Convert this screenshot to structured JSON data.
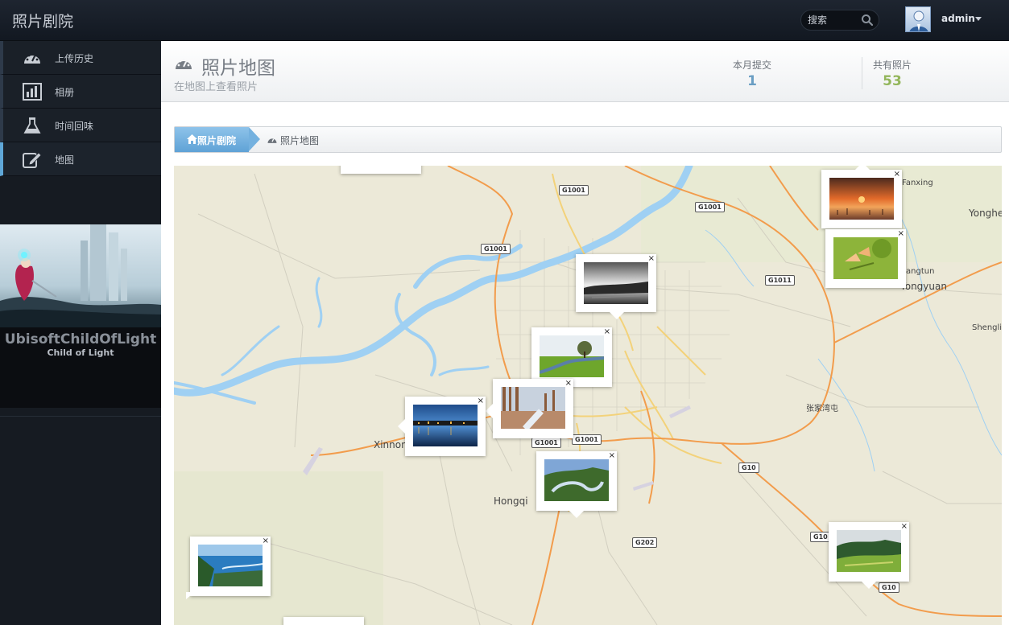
{
  "app": {
    "brand": "照片剧院"
  },
  "navbar": {
    "search_placeholder": "搜索",
    "user_name": "admin"
  },
  "sidebar": {
    "items": [
      {
        "label": "上传历史",
        "icon": "dashboard-icon"
      },
      {
        "label": "相册",
        "icon": "bar-chart-icon"
      },
      {
        "label": "时间回味",
        "icon": "flask-icon"
      },
      {
        "label": "地图",
        "icon": "edit-icon",
        "active": true
      }
    ],
    "banner": {
      "title": "UbisoftChildOfLight",
      "subtitle": "Child of Light"
    }
  },
  "header": {
    "title": "照片地图",
    "subtitle": "在地图上查看照片",
    "stats": [
      {
        "label": "本月提交",
        "value": "1",
        "color": "#6a9ec3"
      },
      {
        "label": "共有照片",
        "value": "53",
        "color": "#93b65b"
      }
    ]
  },
  "breadcrumb": {
    "home": "照片剧院",
    "current": "照片地图"
  },
  "map": {
    "place_labels": [
      "Fanxing",
      "Yonghe",
      "angtun",
      "Yongyuan",
      "Shengli",
      "张家湾屯",
      "Xinnon",
      "Hongqi"
    ],
    "road_shields": [
      "G1001",
      "G1001",
      "G1001",
      "G1011",
      "G1001",
      "G1001",
      "G10",
      "G202",
      "G10",
      "G10"
    ],
    "close_symbol": "×"
  },
  "colors": {
    "accent": "#5fa2d6",
    "river": "#9fd0f3",
    "road_orange": "#f29c4c",
    "road_yellow": "#f3d27a"
  }
}
